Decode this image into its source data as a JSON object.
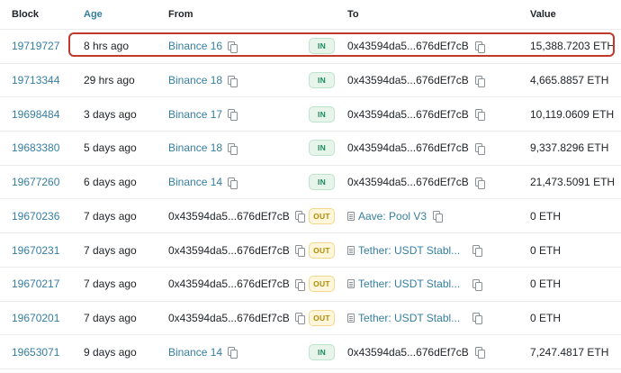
{
  "header": {
    "block": "Block",
    "age": "Age",
    "from": "From",
    "to": "To",
    "value": "Value"
  },
  "rows": [
    {
      "block": "19719727",
      "age": "8 hrs ago",
      "from": "Binance 16",
      "direction": "IN",
      "to": "0x43594da5...676dEf7cB",
      "value": "15,388.7203 ETH"
    },
    {
      "block": "19713344",
      "age": "29 hrs ago",
      "from": "Binance 18",
      "direction": "IN",
      "to": "0x43594da5...676dEf7cB",
      "value": "4,665.8857 ETH"
    },
    {
      "block": "19698484",
      "age": "3 days ago",
      "from": "Binance 17",
      "direction": "IN",
      "to": "0x43594da5...676dEf7cB",
      "value": "10,119.0609 ETH"
    },
    {
      "block": "19683380",
      "age": "5 days ago",
      "from": "Binance 18",
      "direction": "IN",
      "to": "0x43594da5...676dEf7cB",
      "value": "9,337.8296 ETH"
    },
    {
      "block": "19677260",
      "age": "6 days ago",
      "from": "Binance 14",
      "direction": "IN",
      "to": "0x43594da5...676dEf7cB",
      "value": "21,473.5091 ETH"
    },
    {
      "block": "19670236",
      "age": "7 days ago",
      "from": "0x43594da5...676dEf7cB",
      "direction": "OUT",
      "to": "Aave: Pool V3",
      "value": "0 ETH"
    },
    {
      "block": "19670231",
      "age": "7 days ago",
      "from": "0x43594da5...676dEf7cB",
      "direction": "OUT",
      "to": "Tether: USDT Stabl...",
      "value": "0 ETH"
    },
    {
      "block": "19670217",
      "age": "7 days ago",
      "from": "0x43594da5...676dEf7cB",
      "direction": "OUT",
      "to": "Tether: USDT Stabl...",
      "value": "0 ETH"
    },
    {
      "block": "19670201",
      "age": "7 days ago",
      "from": "0x43594da5...676dEf7cB",
      "direction": "OUT",
      "to": "Tether: USDT Stabl...",
      "value": "0 ETH"
    },
    {
      "block": "19653071",
      "age": "9 days ago",
      "from": "Binance 14",
      "direction": "IN",
      "to": "0x43594da5...676dEf7cB",
      "value": "7,247.4817 ETH"
    }
  ],
  "icons": {
    "copy": "copy-icon",
    "contract": "document-icon"
  },
  "colors": {
    "link": "#357ea0",
    "in_badge": "#1b8a5a",
    "out_badge": "#b48a00",
    "highlight": "#c0392b"
  }
}
